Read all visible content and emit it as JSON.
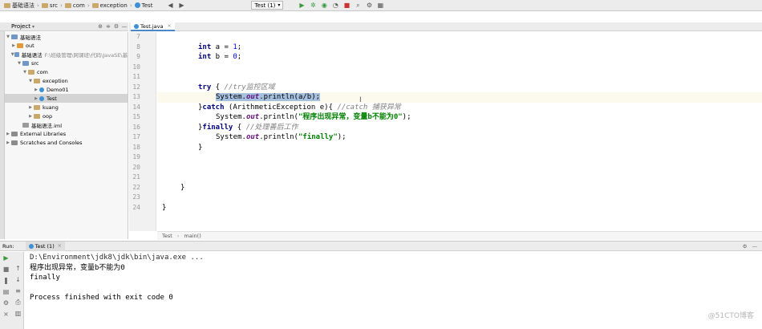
{
  "breadcrumb": [
    {
      "label": "基础语法",
      "icon": "folder-icon"
    },
    {
      "label": "src",
      "icon": "folder-icon"
    },
    {
      "label": "com",
      "icon": "folder-icon"
    },
    {
      "label": "exception",
      "icon": "folder-icon"
    },
    {
      "label": "Test",
      "icon": "class-icon"
    }
  ],
  "run_config": {
    "label": "Test (1)"
  },
  "project_panel": {
    "title": "Project"
  },
  "tree": [
    {
      "label": "基础语法",
      "depth": 0,
      "expanded": true,
      "icon": "module-folder-icon"
    },
    {
      "label": "out",
      "depth": 1,
      "expanded": false,
      "icon": "folder-orange-icon"
    },
    {
      "label": "基础语法",
      "depth": 1,
      "expanded": true,
      "icon": "module-folder-icon",
      "hint": "F:\\班级管理\\网课班\\代码\\JavaSE\\基"
    },
    {
      "label": "src",
      "depth": 2,
      "expanded": true,
      "icon": "source-folder-icon"
    },
    {
      "label": "com",
      "depth": 3,
      "expanded": true,
      "icon": "package-icon"
    },
    {
      "label": "exception",
      "depth": 4,
      "expanded": true,
      "icon": "package-icon"
    },
    {
      "label": "Demo01",
      "depth": 5,
      "expanded": false,
      "icon": "class-icon"
    },
    {
      "label": "Test",
      "depth": 5,
      "expanded": false,
      "icon": "class-icon",
      "selected": true
    },
    {
      "label": "kuang",
      "depth": 4,
      "expanded": false,
      "icon": "package-icon"
    },
    {
      "label": "oop",
      "depth": 4,
      "expanded": false,
      "icon": "package-icon"
    },
    {
      "label": "基础语法.iml",
      "depth": 2,
      "icon": "iml-file-icon"
    },
    {
      "label": "External Libraries",
      "depth": 0,
      "expanded": false,
      "icon": "library-icon"
    },
    {
      "label": "Scratches and Consoles",
      "depth": 0,
      "expanded": false,
      "icon": "scratches-icon"
    }
  ],
  "editor": {
    "tab": "Test.java",
    "line_numbers": [
      "7",
      "8",
      "9",
      "10",
      "11",
      "12",
      "13",
      "14",
      "15",
      "16",
      "17",
      "18",
      "19",
      "20",
      "21",
      "22",
      "23",
      "24"
    ],
    "code": {
      "l8_kw": "int",
      "l8_rest": " a = ",
      "l8_num": "1",
      "l8_end": ";",
      "l9_kw": "int",
      "l9_rest": " b = ",
      "l9_num": "0",
      "l9_end": ";",
      "l12_kw": "try",
      "l12_rest": " { ",
      "l12_cm": "//try监控区域",
      "l13_sel_a": "System.",
      "l13_sel_b": "out",
      "l13_sel_c": ".println(a/b);",
      "l14_a": "}",
      "l14_kw": "catch",
      "l14_b": " (ArithmeticException e){ ",
      "l14_cm": "//catch 捕获异常",
      "l15_a": "System.",
      "l15_b": "out",
      "l15_c": ".println(",
      "l15_str": "\"程序出现异常，变量b不能为0\"",
      "l15_d": ");",
      "l16_a": "}",
      "l16_kw": "finally",
      "l16_b": " { ",
      "l16_cm": "//处理善后工作",
      "l17_a": "System.",
      "l17_b": "out",
      "l17_c": ".println(",
      "l17_str": "\"finally\"",
      "l17_d": ");",
      "l18": "}",
      "l22": "}",
      "l24": "}"
    },
    "status_breadcrumb": [
      "Test",
      "main()"
    ]
  },
  "run": {
    "label": "Run:",
    "tab": "Test (1)",
    "console": [
      "D:\\Environment\\jdk8\\jdk\\bin\\java.exe ...",
      "程序出现异常，变量b不能为0",
      "finally",
      "",
      "Process finished with exit code 0"
    ]
  },
  "watermark": "@51CTO博客"
}
